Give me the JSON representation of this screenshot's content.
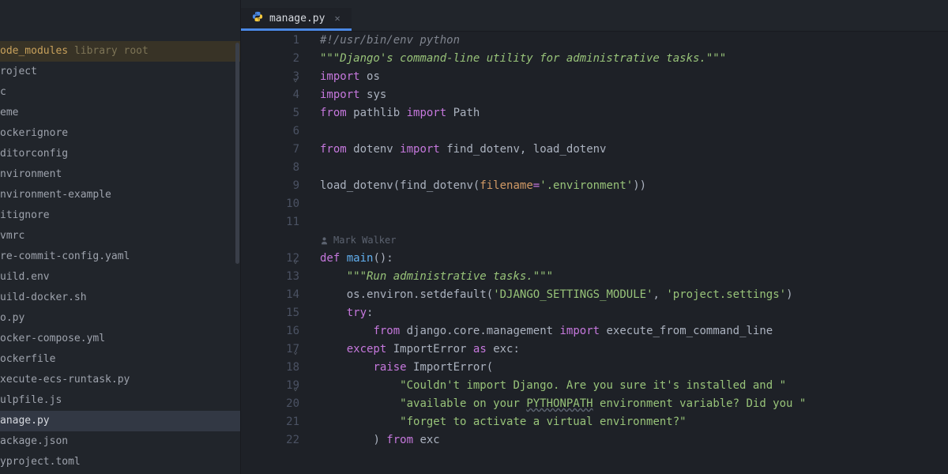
{
  "sidebar": {
    "items": [
      {
        "label": "ode_modules",
        "suffix": " library root",
        "kind": "library-root"
      },
      {
        "label": "roject"
      },
      {
        "label": "c"
      },
      {
        "label": "eme"
      },
      {
        "label": "ockerignore"
      },
      {
        "label": "ditorconfig"
      },
      {
        "label": "nvironment"
      },
      {
        "label": "nvironment-example"
      },
      {
        "label": "itignore"
      },
      {
        "label": "vmrc"
      },
      {
        "label": "re-commit-config.yaml"
      },
      {
        "label": "uild.env"
      },
      {
        "label": "uild-docker.sh"
      },
      {
        "label": "o.py"
      },
      {
        "label": "ocker-compose.yml"
      },
      {
        "label": "ockerfile"
      },
      {
        "label": "xecute-ecs-runtask.py"
      },
      {
        "label": "ulpfile.js"
      },
      {
        "label": "anage.py",
        "selected": true
      },
      {
        "label": "ackage.json"
      },
      {
        "label": "yproject.toml"
      }
    ]
  },
  "tab": {
    "filename": "manage.py"
  },
  "annotation": {
    "author": "Mark Walker"
  },
  "code": {
    "lines": [
      {
        "n": 1,
        "tokens": [
          [
            "#!/usr/bin/env python",
            "c-comment"
          ]
        ]
      },
      {
        "n": 2,
        "tokens": [
          [
            "\"\"\"Django's command-line utility for administrative tasks.\"\"\"",
            "c-string c-comment"
          ]
        ]
      },
      {
        "n": 3,
        "fold": true,
        "tokens": [
          [
            "import ",
            "c-keyword"
          ],
          [
            "os",
            "c-ident"
          ]
        ]
      },
      {
        "n": 4,
        "tokens": [
          [
            "import ",
            "c-keyword"
          ],
          [
            "sys",
            "c-ident"
          ]
        ]
      },
      {
        "n": 5,
        "tokens": [
          [
            "from ",
            "c-keyword"
          ],
          [
            "pathlib ",
            "c-ident"
          ],
          [
            "import ",
            "c-keyword"
          ],
          [
            "Path",
            "c-ident"
          ]
        ]
      },
      {
        "n": 6,
        "tokens": []
      },
      {
        "n": 7,
        "tokens": [
          [
            "from ",
            "c-keyword"
          ],
          [
            "dotenv ",
            "c-ident"
          ],
          [
            "import ",
            "c-keyword"
          ],
          [
            "find_dotenv, load_dotenv",
            "c-ident"
          ]
        ]
      },
      {
        "n": 8,
        "tokens": []
      },
      {
        "n": 9,
        "tokens": [
          [
            "load_dotenv",
            "c-ident"
          ],
          [
            "(",
            "c-punct"
          ],
          [
            "find_dotenv",
            "c-ident"
          ],
          [
            "(",
            "c-punct"
          ],
          [
            "filename",
            "c-param"
          ],
          [
            "=",
            "c-op"
          ],
          [
            "'.environment'",
            "c-string"
          ],
          [
            "))",
            "c-punct"
          ]
        ]
      },
      {
        "n": 10,
        "tokens": []
      },
      {
        "n": 11,
        "tokens": []
      },
      {
        "annotation": true
      },
      {
        "n": 12,
        "fold": true,
        "tokens": [
          [
            "def ",
            "c-keyword"
          ],
          [
            "main",
            "c-func"
          ],
          [
            "():",
            "c-punct"
          ]
        ]
      },
      {
        "n": 13,
        "tokens": [
          [
            "    ",
            ""
          ],
          [
            "\"\"\"Run administrative tasks.\"\"\"",
            "c-string c-comment"
          ]
        ]
      },
      {
        "n": 14,
        "tokens": [
          [
            "    ",
            ""
          ],
          [
            "os",
            "c-ident"
          ],
          [
            ".",
            "c-punct"
          ],
          [
            "environ",
            "c-ident"
          ],
          [
            ".",
            "c-punct"
          ],
          [
            "setdefault",
            "c-ident"
          ],
          [
            "(",
            "c-punct"
          ],
          [
            "'DJANGO_SETTINGS_MODULE'",
            "c-string"
          ],
          [
            ", ",
            "c-punct"
          ],
          [
            "'project.settings'",
            "c-string"
          ],
          [
            ")",
            "c-punct"
          ]
        ]
      },
      {
        "n": 15,
        "tokens": [
          [
            "    ",
            ""
          ],
          [
            "try",
            "c-keyword"
          ],
          [
            ":",
            "c-punct"
          ]
        ]
      },
      {
        "n": 16,
        "tokens": [
          [
            "        ",
            ""
          ],
          [
            "from ",
            "c-keyword"
          ],
          [
            "django",
            "c-ident"
          ],
          [
            ".",
            "c-punct"
          ],
          [
            "core",
            "c-ident"
          ],
          [
            ".",
            "c-punct"
          ],
          [
            "management ",
            "c-ident"
          ],
          [
            "import ",
            "c-keyword"
          ],
          [
            "execute_from_command_line",
            "c-ident"
          ]
        ]
      },
      {
        "n": 17,
        "fold": true,
        "tokens": [
          [
            "    ",
            ""
          ],
          [
            "except ",
            "c-keyword"
          ],
          [
            "ImportError ",
            "c-ident"
          ],
          [
            "as ",
            "c-keyword"
          ],
          [
            "exc",
            "c-ident"
          ],
          [
            ":",
            "c-punct"
          ]
        ]
      },
      {
        "n": 18,
        "tokens": [
          [
            "        ",
            ""
          ],
          [
            "raise ",
            "c-keyword"
          ],
          [
            "ImportError",
            "c-ident"
          ],
          [
            "(",
            "c-punct"
          ]
        ]
      },
      {
        "n": 19,
        "fold": true,
        "tokens": [
          [
            "            ",
            ""
          ],
          [
            "\"Couldn't import Django. Are you sure it's installed and \"",
            "c-string"
          ]
        ]
      },
      {
        "n": 20,
        "tokens": [
          [
            "            ",
            ""
          ],
          [
            "\"available on your ",
            "c-string"
          ],
          [
            "PYTHONPATH",
            "c-string underline-wavy"
          ],
          [
            " environment variable? Did you \"",
            "c-string"
          ]
        ]
      },
      {
        "n": 21,
        "tokens": [
          [
            "            ",
            ""
          ],
          [
            "\"forget to activate a virtual environment?\"",
            "c-string"
          ]
        ]
      },
      {
        "n": 22,
        "tokens": [
          [
            "        ",
            ""
          ],
          [
            ") ",
            "c-punct"
          ],
          [
            "from ",
            "c-keyword"
          ],
          [
            "exc",
            "c-ident"
          ]
        ]
      }
    ]
  }
}
